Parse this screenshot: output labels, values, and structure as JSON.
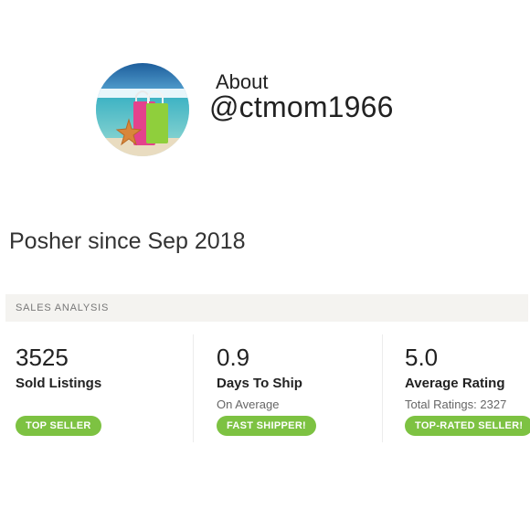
{
  "profile": {
    "about_label": "About",
    "username": "@ctmom1966",
    "posher_since": "Posher since Sep 2018"
  },
  "sales_analysis": {
    "header": "SALES ANALYSIS",
    "stats": [
      {
        "value": "3525",
        "title": "Sold Listings",
        "subtitle": "",
        "badge": "TOP SELLER"
      },
      {
        "value": "0.9",
        "title": "Days To Ship",
        "subtitle": "On Average",
        "badge": "FAST SHIPPER!"
      },
      {
        "value": "5.0",
        "title": "Average Rating",
        "subtitle": "Total Ratings: 2327",
        "badge": "TOP-RATED SELLER!"
      }
    ]
  },
  "colors": {
    "badge_green": "#7dc242",
    "header_background": "#f4f3f0"
  }
}
